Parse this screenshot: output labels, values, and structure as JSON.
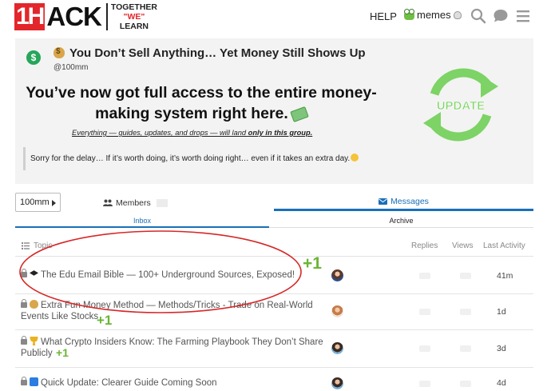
{
  "header": {
    "logo_1h": "1H",
    "logo_ack": "ACK",
    "tagline_line1": "TOGETHER",
    "tagline_line2": "\"WE\"",
    "tagline_line3": "LEARN",
    "help_label": "HELP",
    "username": "memes",
    "icons": [
      "search-icon",
      "chat-icon",
      "hamburger-menu-icon"
    ]
  },
  "banner": {
    "category_icon": "dollar-badge-icon",
    "title": "You Don’t Sell Anything… Yet Money Still Shows Up",
    "handle": "@100mm",
    "headline": "You’ve now got full access to the entire money-making system right here.",
    "subline_prefix": "Everything — guides, updates, and drops — will land ",
    "subline_bold": "only in this group.",
    "quote": "Sorry for the delay… If it’s worth doing, it’s worth doing right… even if it takes an extra day.",
    "badge_text": "UPDATE",
    "colors": {
      "badge_green": "#7dd365",
      "badge_text": "#ffffff"
    }
  },
  "nav": {
    "group_select": "100mm",
    "members_label": "Members",
    "messages_label": "Messages",
    "inbox_label": "Inbox",
    "archive_label": "Archive",
    "accent": "#1a6fb8"
  },
  "topic_list": {
    "columns": [
      "Topic",
      "Replies",
      "Views",
      "Last Activity"
    ],
    "rows": [
      {
        "title": "The Edu Email Bible — 100+ Underground Sources, Exposed!",
        "emoji": "graduation-cap-icon",
        "activity": "41m",
        "annotation": "+1"
      },
      {
        "title": "Extra Fun Money Method — Methods/Tricks - Trade on Real-World Events Like Stocks",
        "emoji": "money-bag-icon",
        "activity": "1d",
        "annotation": "+1"
      },
      {
        "title": "What Crypto Insiders Know: The Farming Playbook They Don’t Share Publicly",
        "emoji": "trophy-icon",
        "activity": "3d",
        "annotation": "+1"
      },
      {
        "title": "Quick Update: Clearer Guide Coming Soon",
        "emoji": "info-icon",
        "activity": "4d",
        "annotation": ""
      }
    ]
  },
  "annotation_color": "#6bb535",
  "highlight_color": "#d62828"
}
